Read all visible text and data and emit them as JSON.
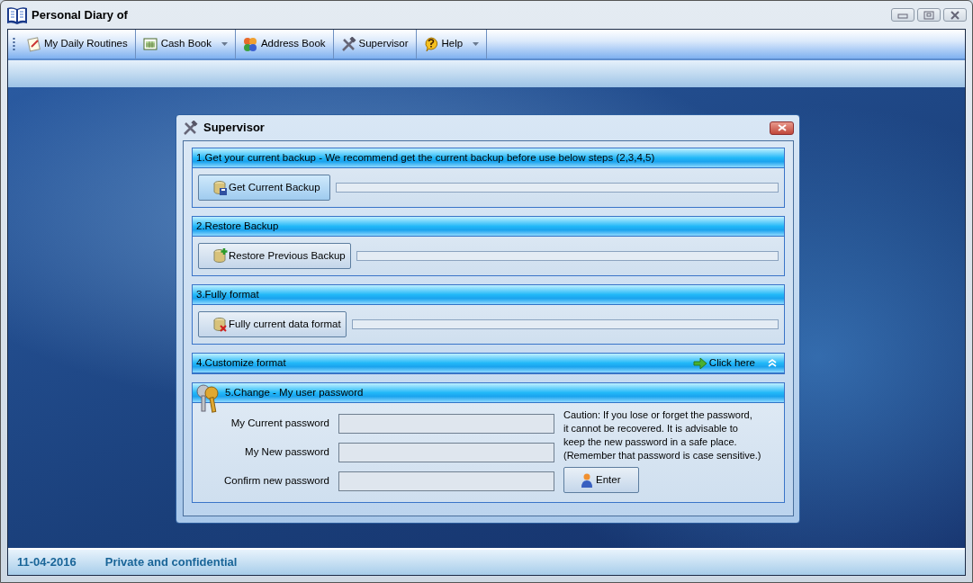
{
  "window": {
    "title": "Personal Diary of"
  },
  "toolbar": [
    {
      "label": "My Daily Routines",
      "dropdown": false
    },
    {
      "label": "Cash Book",
      "dropdown": true
    },
    {
      "label": "Address Book",
      "dropdown": false
    },
    {
      "label": "Supervisor",
      "dropdown": false
    },
    {
      "label": "Help",
      "dropdown": true
    }
  ],
  "dialog": {
    "title": "Supervisor",
    "sections": [
      {
        "kind": "action",
        "title": "1.Get your current backup - We recommend get the current backup before use below steps (2,3,4,5)",
        "button": "Get Current Backup",
        "progress": {
          "level": 0
        }
      },
      {
        "kind": "action",
        "title": "2.Restore Backup",
        "button": "Restore Previous Backup",
        "progress": {
          "level": 0
        }
      },
      {
        "kind": "action",
        "title": "3.Fully format",
        "button": "Fully current data format",
        "progress": {
          "level": 0
        }
      },
      {
        "kind": "link",
        "title": "4.Customize format",
        "link": "Click here",
        "expanded": false
      },
      {
        "kind": "password",
        "title": "5.Change - My user password",
        "fields": [
          {
            "label": "My Current password"
          },
          {
            "label": "My New password"
          },
          {
            "label": "Confirm new password"
          }
        ],
        "caution_lines": [
          "Caution: If you lose or forget the password,",
          "it cannot be recovered. It is advisable to",
          "keep the new password in a safe place.",
          "(Remember that password is case sensitive.)"
        ],
        "button": "Enter"
      }
    ]
  },
  "status_bar": {
    "date": "11-04-2016",
    "note": "Private and confidential"
  }
}
